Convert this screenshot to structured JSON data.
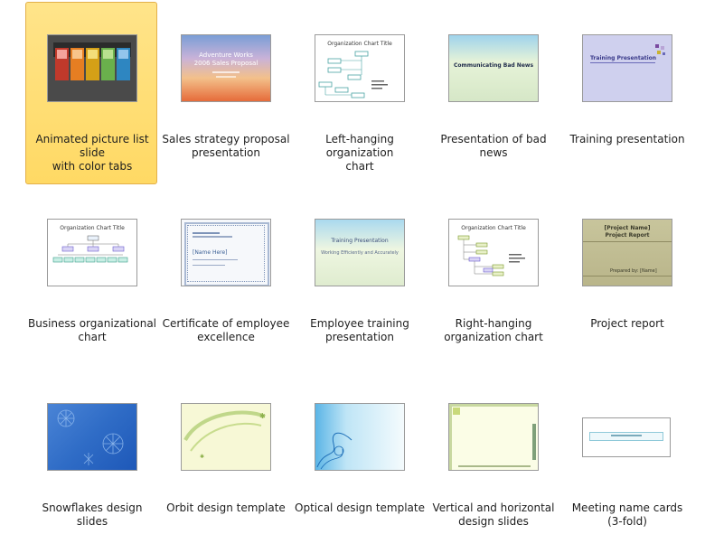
{
  "templates": [
    {
      "label": "Animated picture list slide\nwith color tabs",
      "selected": true
    },
    {
      "label": "Sales strategy  proposal\npresentation",
      "title": "Adventure Works",
      "subtitle": "2006 Sales Proposal"
    },
    {
      "label": "Left-hanging organization\nchart",
      "title": "Organization Chart Title"
    },
    {
      "label": "Presentation of bad news",
      "title": "Communicating Bad News"
    },
    {
      "label": "Training presentation",
      "title": "Training Presentation"
    },
    {
      "label": "Business organizational\nchart",
      "title": "Organization Chart Title"
    },
    {
      "label": "Certificate of employee\nexcellence",
      "name": "[Name Here]"
    },
    {
      "label": "Employee training\npresentation",
      "title": "Training Presentation",
      "subtitle": "Working Efficiently and Accurately"
    },
    {
      "label": "Right-hanging\norganization chart",
      "title": "Organization Chart Title"
    },
    {
      "label": "Project report",
      "title": "[Project Name]",
      "subtitle": "Project Report",
      "presenter": "Prepared by: [Name]"
    },
    {
      "label": "Snowflakes design slides"
    },
    {
      "label": "Orbit design template"
    },
    {
      "label": "Optical design template"
    },
    {
      "label": "Vertical and horizontal\ndesign slides"
    },
    {
      "label": "Meeting name cards\n(3-fold)"
    }
  ],
  "colors": {
    "selection_fill": "#ffd964",
    "selection_border": "#e3b04a",
    "tab_colors": [
      "#c0392b",
      "#e67e22",
      "#d4a017",
      "#6ab04c",
      "#2e86c1"
    ]
  }
}
